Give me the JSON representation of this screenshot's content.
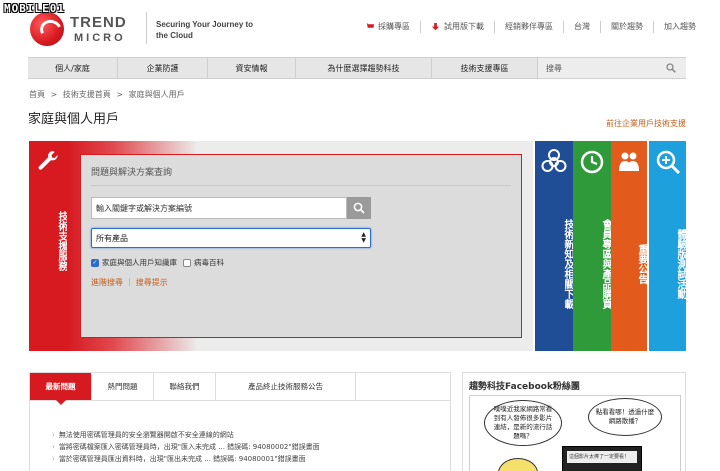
{
  "watermark": "MOBILE01",
  "brand": {
    "logo_line1": "TREND",
    "logo_line2": "MICRO",
    "tagline": "Securing Your Journey to the Cloud"
  },
  "top_links": [
    {
      "label": "採購專區",
      "icon": "cart-icon"
    },
    {
      "label": "試用版下載",
      "icon": "download-icon"
    },
    {
      "label": "經銷夥伴專區"
    },
    {
      "label": "台灣"
    },
    {
      "label": "關於趨勢"
    },
    {
      "label": "加入趨勢"
    }
  ],
  "nav": {
    "items": [
      "個人/家庭",
      "企業防護",
      "資安情報",
      "為什麼選擇趨勢科技",
      "技術支援專區"
    ],
    "search_label": "搜尋"
  },
  "breadcrumb": [
    "首頁",
    ">",
    "技術支援首頁",
    ">",
    "家庭與個人用戶"
  ],
  "page_title": "家庭與個人用戶",
  "enterprise_link": "前往企業用戶技術支援",
  "support_tab": "技術支援服務",
  "search_panel": {
    "title": "問題與解決方案查詢",
    "keyword_placeholder": "輸入關鍵字或解決方案編號",
    "product_select": "所有產品",
    "options": [
      {
        "label": "家庭與個人用戶知識庫",
        "checked": true
      },
      {
        "label": "病毒百科",
        "checked": false
      }
    ],
    "advanced_search": "進階搜尋",
    "search_tips": "搜尋提示"
  },
  "feature_tabs": [
    {
      "label": "技術新知及相關下載",
      "color": "#1f4e96",
      "icon": "biohazard-icon"
    },
    {
      "label": "會員專區與產品購買",
      "color": "#2f9a3a",
      "icon": "clock-icon"
    },
    {
      "label": "重要公告",
      "color": "#e25a1c",
      "icon": "people-icon"
    },
    {
      "label": "體驗版測試活動",
      "color": "#1ea0dc",
      "icon": "magnifier-plus-icon"
    }
  ],
  "bottom_tabs": [
    "最新問題",
    "熱門問題",
    "聯絡我們",
    "產品終止技術服務公告"
  ],
  "faq": [
    "無法使用密碼管理員的安全瀏覽器開啟不安全連線的網站",
    "當將密碼檔案匯入密碼管理員時，出現\"匯入未完成 ... 錯誤碼: 94080002\"錯誤畫面",
    "當於密碼管理員匯出資料時，出現\"匯出未完成 ... 錯誤碼: 94080001\"錯誤畫面"
  ],
  "facebook": {
    "title": "趨勢科技Facebook粉絲團",
    "bubble1": "噗噗近我家網路常看到有人發佈很多影片連結，是新的流行話題嗎？",
    "bubble2": "點看看哪！透過什麼網路散播？",
    "screen_text": "這個影片太棒了一定要看！"
  }
}
